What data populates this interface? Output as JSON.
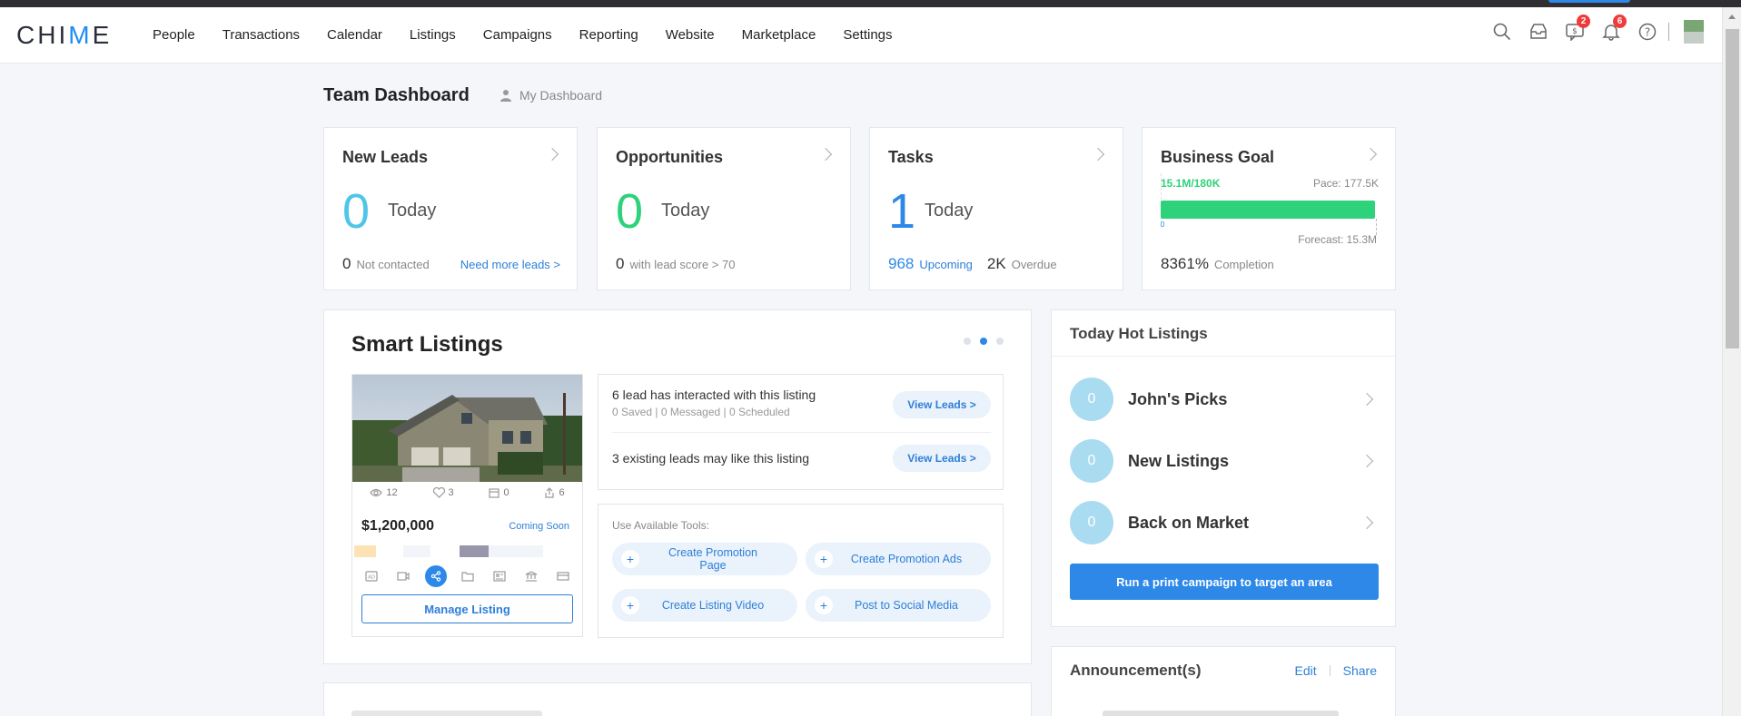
{
  "nav": {
    "logo_pre": "CHI",
    "logo_v": "M",
    "logo_post": "E",
    "items": [
      "People",
      "Transactions",
      "Calendar",
      "Listings",
      "Campaigns",
      "Reporting",
      "Website",
      "Marketplace",
      "Settings"
    ],
    "badges": {
      "chat": "2",
      "notifications": "6"
    }
  },
  "header": {
    "title": "Team Dashboard",
    "switch_label": "My Dashboard"
  },
  "stats": {
    "new_leads": {
      "title": "New Leads",
      "count": "0",
      "period": "Today",
      "foot_count": "0",
      "foot_label": "Not contacted",
      "link": "Need more leads >"
    },
    "opportunities": {
      "title": "Opportunities",
      "count": "0",
      "period": "Today",
      "foot_count": "0",
      "foot_label": "with lead score > 70"
    },
    "tasks": {
      "title": "Tasks",
      "count": "1",
      "period": "Today",
      "upcoming_count": "968",
      "upcoming_label": "Upcoming",
      "overdue_count": "2K",
      "overdue_label": "Overdue"
    },
    "goal": {
      "title": "Business Goal",
      "progress": "15.1M/180K",
      "pace": "Pace: 177.5K",
      "tick": "0",
      "forecast": "Forecast: 15.3M",
      "completion_value": "8361%",
      "completion_label": "Completion",
      "fill_percent": 100
    }
  },
  "smart": {
    "title": "Smart Listings",
    "listing": {
      "views": "12",
      "likes": "3",
      "saves": "0",
      "shares": "6",
      "price": "$1,200,000",
      "status": "Coming Soon",
      "manage": "Manage Listing"
    },
    "interact": {
      "line1": "6 lead has interacted with this listing",
      "line1_sub": "0 Saved | 0 Messaged | 0 Scheduled",
      "line2": "3 existing leads may like this listing",
      "button": "View Leads >"
    },
    "tools": {
      "title": "Use Available Tools:",
      "buttons": [
        "Create Promotion Page",
        "Create Promotion Ads",
        "Create Listing Video",
        "Post to Social Media"
      ]
    }
  },
  "hot": {
    "title": "Today Hot Listings",
    "items": [
      {
        "count": "0",
        "label": "John's Picks"
      },
      {
        "count": "0",
        "label": "New Listings"
      },
      {
        "count": "0",
        "label": "Back on Market"
      }
    ],
    "cta": "Run a print campaign to target an area"
  },
  "announcement": {
    "title": "Announcement(s)",
    "edit": "Edit",
    "share": "Share"
  },
  "colors": {
    "primary": "#2d88e8",
    "green": "#2ed27a",
    "teal": "#4fc6e8",
    "hot_circle": "#a9dbf1"
  }
}
